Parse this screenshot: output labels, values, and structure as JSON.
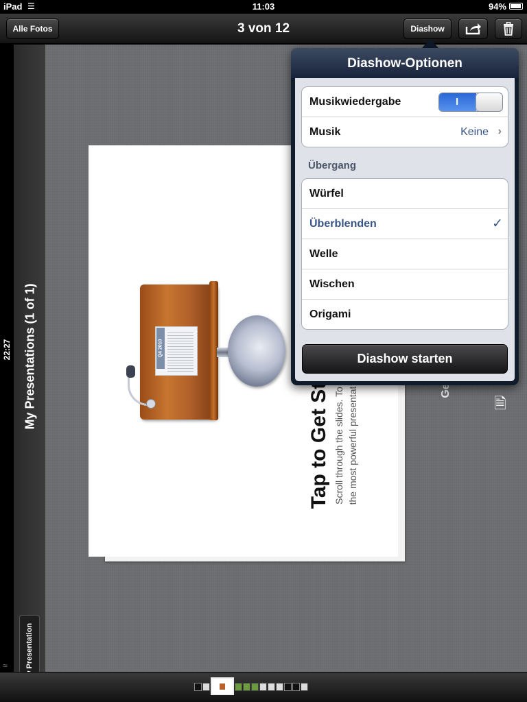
{
  "status_bar": {
    "carrier": "iPad",
    "time": "11:03",
    "battery": "94%"
  },
  "nav": {
    "title": "3 von 12",
    "back_label": "Alle Fotos",
    "slideshow_label": "Diashow"
  },
  "side": {
    "title": "My Presentations (1 of 1)",
    "clock": "22:27",
    "new_presentation": "New Presentation",
    "device": "iPad"
  },
  "slide": {
    "heading": "Tap to Get St",
    "line1": "Scroll through the slides. To",
    "line2": "the most powerful presentat",
    "paper_tab": "Q4 2010",
    "background_text": "Ge"
  },
  "popover": {
    "title": "Diashow-Optionen",
    "music_playback_label": "Musikwiedergabe",
    "music_playback_on": true,
    "toggle_on_glyph": "I",
    "music_label": "Musik",
    "music_value": "Keine",
    "transition_header": "Übergang",
    "transitions": [
      {
        "label": "Würfel",
        "selected": false
      },
      {
        "label": "Überblenden",
        "selected": true
      },
      {
        "label": "Welle",
        "selected": false
      },
      {
        "label": "Wischen",
        "selected": false
      },
      {
        "label": "Origami",
        "selected": false
      }
    ],
    "start_label": "Diashow starten"
  },
  "icons": {
    "share": "share-icon",
    "trash": "trash-icon",
    "wifi": "wifi-icon",
    "battery": "battery-icon",
    "chevron": "chevron-right-icon",
    "checkmark": "checkmark-icon"
  },
  "colors": {
    "selected_text": "#385487",
    "toggle_on": "#2a68d6"
  }
}
